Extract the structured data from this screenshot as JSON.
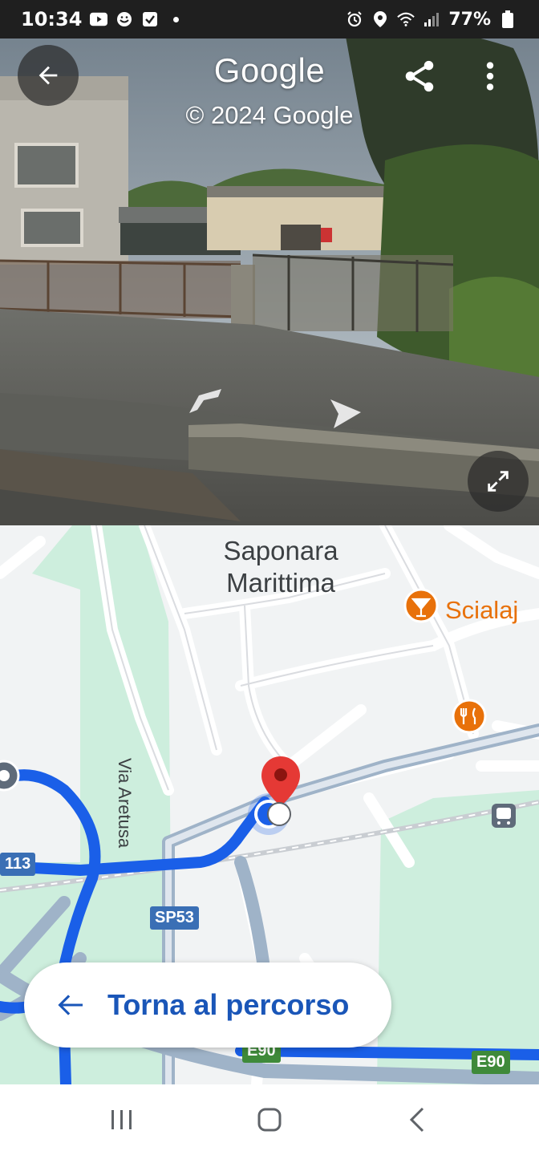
{
  "status_bar": {
    "time": "10:34",
    "battery": "77%",
    "left_icons": [
      "youtube-icon",
      "smiley-icon",
      "checkbox-icon",
      "dot-icon"
    ],
    "right_icons": [
      "alarm-icon",
      "location-icon",
      "wifi-icon",
      "signal-icon",
      "battery-icon"
    ]
  },
  "street_view": {
    "brand": "Google",
    "copyright": "© 2024 Google",
    "back_icon": "arrow-left-icon",
    "share_icon": "share-icon",
    "more_icon": "more-vert-icon",
    "expand_icon": "expand-icon"
  },
  "map": {
    "place_name_line1": "Saponara",
    "place_name_line2": "Marittima",
    "poi_bar": "Scialaj",
    "road_via_aretusa": "Via Aretusa",
    "shield_113": "113",
    "shield_sp53": "SP53",
    "shield_e90_left": "E90",
    "shield_e90_right": "E90",
    "accent_route": "#1a5fe8",
    "pin_color": "#e53935"
  },
  "return_button": {
    "label": "Torna al percorso"
  },
  "nav_bar": {
    "icons": [
      "recents-icon",
      "home-icon",
      "back-icon"
    ]
  }
}
